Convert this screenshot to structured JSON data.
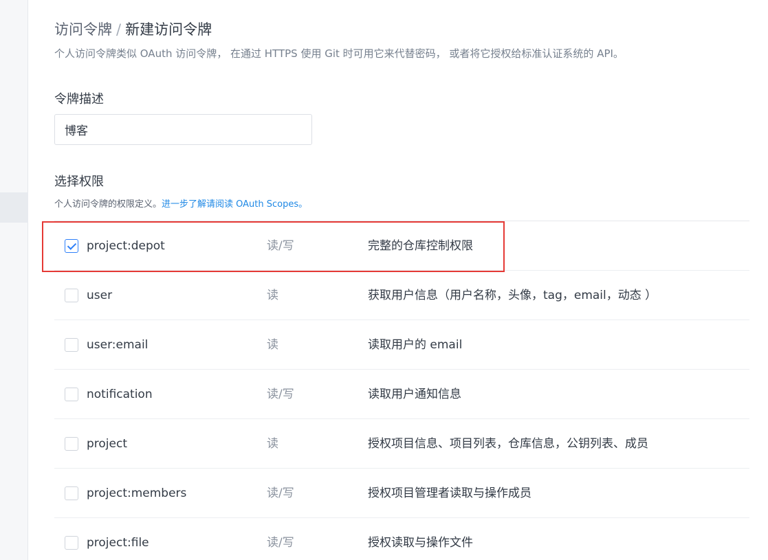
{
  "breadcrumb": {
    "root": "访问令牌",
    "separator": "/",
    "current": "新建访问令牌"
  },
  "intro_text": "个人访问令牌类似 OAuth 访问令牌， 在通过 HTTPS 使用 Git 时可用它来代替密码， 或者将它授权给标准认证系统的 API。",
  "description_field": {
    "label": "令牌描述",
    "value": "博客"
  },
  "scope_section": {
    "label": "选择权限",
    "hint_prefix": "个人访问令牌的权限定义。",
    "hint_link": "进一步了解请阅读 OAuth Scopes。"
  },
  "scopes": [
    {
      "name": "project:depot",
      "access": "读/写",
      "description": "完整的仓库控制权限",
      "checked": true
    },
    {
      "name": "user",
      "access": "读",
      "description": "获取用户信息（用户名称，头像，tag，email，动态 ）",
      "checked": false
    },
    {
      "name": "user:email",
      "access": "读",
      "description": "读取用户的 email",
      "checked": false
    },
    {
      "name": "notification",
      "access": "读/写",
      "description": "读取用户通知信息",
      "checked": false
    },
    {
      "name": "project",
      "access": "读",
      "description": "授权项目信息、项目列表，仓库信息，公钥列表、成员",
      "checked": false
    },
    {
      "name": "project:members",
      "access": "读/写",
      "description": "授权项目管理者读取与操作成员",
      "checked": false
    },
    {
      "name": "project:file",
      "access": "读/写",
      "description": "授权读取与操作文件",
      "checked": false
    }
  ],
  "colors": {
    "accent": "#2d7ff9",
    "link": "#1e88e5",
    "highlight": "#e53935"
  }
}
